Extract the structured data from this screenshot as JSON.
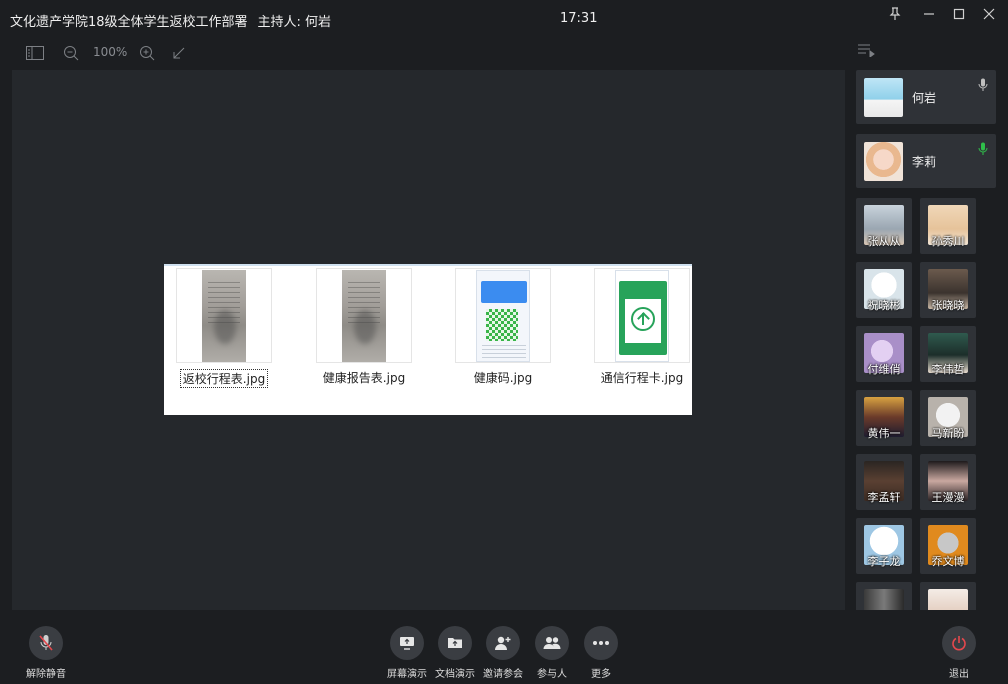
{
  "window": {
    "title": "文化遗产学院18级全体学生返校工作部署",
    "host": "主持人: 何岩",
    "time": "17:31"
  },
  "toolbar": {
    "zoom": "100%"
  },
  "document": {
    "files": [
      {
        "name": "返校行程表.jpg",
        "selected": true
      },
      {
        "name": "健康报告表.jpg",
        "selected": false
      },
      {
        "name": "健康码.jpg",
        "selected": false
      },
      {
        "name": "通信行程卡.jpg",
        "selected": false
      }
    ]
  },
  "participants": {
    "featured": [
      {
        "name": "何岩",
        "mic": "muted-gray"
      },
      {
        "name": "李莉",
        "mic": "active-green"
      }
    ],
    "grid": [
      {
        "name": "张从从"
      },
      {
        "name": "孙秀川"
      },
      {
        "name": "祝晓彬"
      },
      {
        "name": "张晓晓"
      },
      {
        "name": "付维俏"
      },
      {
        "name": "李伟哲"
      },
      {
        "name": "黄伟一"
      },
      {
        "name": "马新盼"
      },
      {
        "name": "李孟轩"
      },
      {
        "name": "王漫漫"
      },
      {
        "name": "李子龙"
      },
      {
        "name": "乔文博"
      }
    ]
  },
  "bottombar": {
    "unmute": "解除静音",
    "screen_share": "屏幕演示",
    "doc_share": "文档演示",
    "invite": "邀请参会",
    "participants": "参与人",
    "more": "更多",
    "exit": "退出"
  },
  "colors": {
    "accent_exit": "#e5484d",
    "mic_active": "#2fbf4a"
  }
}
